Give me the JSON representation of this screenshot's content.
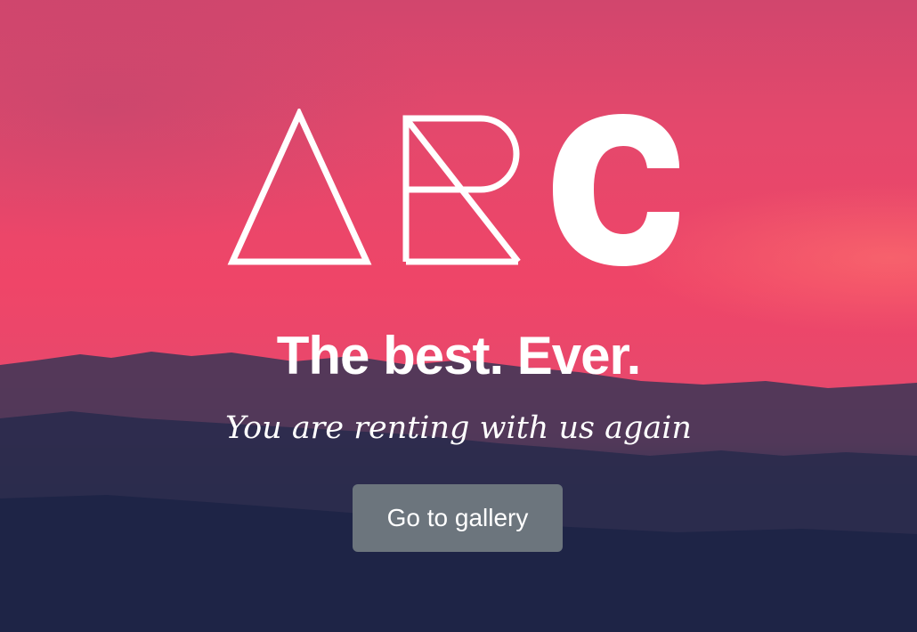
{
  "brand": {
    "logo_text": "ARC",
    "logo_icon": "arc-logo-icon"
  },
  "hero": {
    "headline": "The best. Ever.",
    "tagline": "You are renting with us again",
    "cta_label": "Go to gallery",
    "background": "sunset-mountains-image"
  },
  "colors": {
    "sky_pink": "#ef4568",
    "mountain_navy": "#1f2547",
    "button_gray": "#6c757d",
    "text": "#ffffff"
  }
}
